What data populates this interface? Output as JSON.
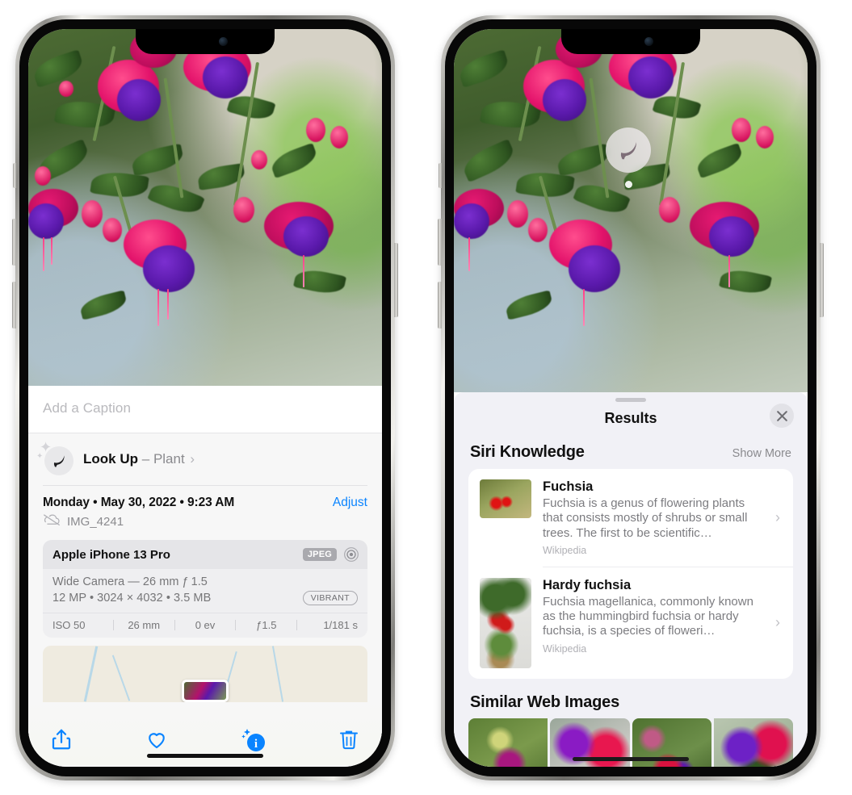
{
  "left_phone": {
    "caption": {
      "placeholder": "Add a Caption",
      "value": ""
    },
    "look_up": {
      "icon": "leaf-icon",
      "label": "Look Up",
      "dash": "–",
      "subject": "Plant",
      "chevron": "›"
    },
    "metadata": {
      "date_line": "Monday • May 30, 2022 • 9:23 AM",
      "adjust_label": "Adjust",
      "cloud_icon": "cloud-slash-icon",
      "file_name": "IMG_4241"
    },
    "camera_card": {
      "device": "Apple iPhone 13 Pro",
      "format_badge": "JPEG",
      "aperture_icon": "aperture-icon",
      "lens_line": "Wide Camera — 26 mm ƒ 1.5",
      "size_line": "12 MP • 3024 × 4032 • 3.5 MB",
      "quality_badge": "VIBRANT",
      "exif": [
        "ISO 50",
        "26 mm",
        "0 ev",
        "ƒ1.5",
        "1/181 s"
      ]
    },
    "toolbar": [
      {
        "name": "share-button",
        "icon": "share-icon"
      },
      {
        "name": "favorite-button",
        "icon": "heart-icon"
      },
      {
        "name": "info-button",
        "icon": "info-sparkle-icon"
      },
      {
        "name": "delete-button",
        "icon": "trash-icon"
      }
    ]
  },
  "right_phone": {
    "visual_lookup_badge": {
      "icon": "leaf-icon"
    },
    "sheet": {
      "title": "Results",
      "close_icon": "close-icon",
      "grabber": "drag-handle"
    },
    "siri_knowledge": {
      "heading": "Siri Knowledge",
      "show_more": "Show More",
      "items": [
        {
          "title": "Fuchsia",
          "description": "Fuchsia is a genus of flowering plants that consists mostly of shrubs or small trees. The first to be scientific…",
          "source": "Wikipedia",
          "chevron": "›"
        },
        {
          "title": "Hardy fuchsia",
          "description": "Fuchsia magellanica, commonly known as the hummingbird fuchsia or hardy fuchsia, is a species of floweri…",
          "source": "Wikipedia",
          "chevron": "›"
        }
      ]
    },
    "similar_web_images": {
      "heading": "Similar Web Images",
      "count": 4
    }
  },
  "colors": {
    "accent_blue": "#0a84ff",
    "sheet_bg": "#f1f1f6",
    "card_bg": "#ffffff",
    "secondary_text": "#8a8a8e"
  }
}
